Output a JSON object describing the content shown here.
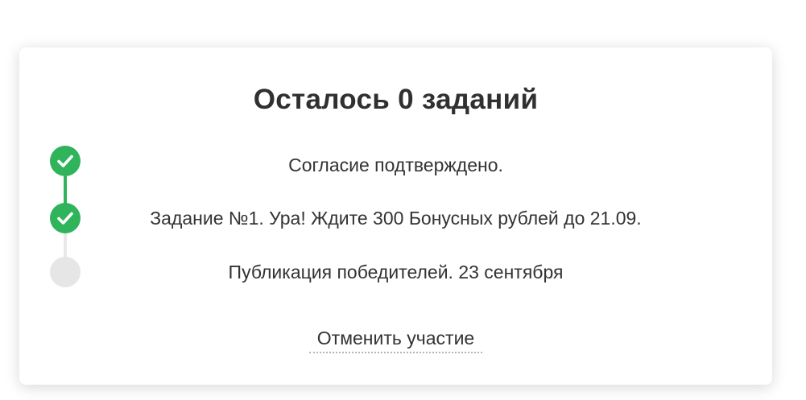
{
  "card": {
    "title": "Осталось 0 заданий",
    "steps": [
      {
        "label": "Согласие подтверждено.",
        "status": "done",
        "icon": "check-icon"
      },
      {
        "label": "Задание №1. Ура! Ждите 300 Бонусных рублей до 21.09.",
        "status": "done",
        "icon": "check-icon"
      },
      {
        "label": "Публикация победителей. 23 сентября",
        "status": "pending",
        "icon": "empty-circle-icon"
      }
    ],
    "cancel_label": "Отменить участие"
  },
  "colors": {
    "accent_green": "#2fb35b",
    "pending_gray": "#e6e6e6",
    "text": "#333333"
  }
}
